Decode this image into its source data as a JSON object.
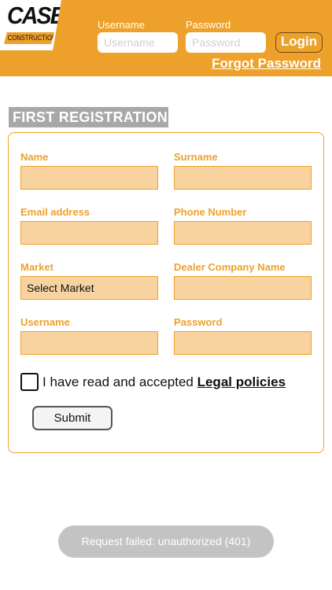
{
  "header": {
    "logo": {
      "brand": "CASE",
      "sub": "CONSTRUCTION"
    },
    "username_label": "Username",
    "username_placeholder": "Username",
    "password_label": "Password",
    "password_placeholder": "Password",
    "login_label": "Login",
    "forgot_label": "Forgot Password"
  },
  "form": {
    "title": "FIRST REGISTRATION",
    "fields": {
      "name": "Name",
      "surname": "Surname",
      "email": "Email address",
      "phone": "Phone Number",
      "market": "Market",
      "market_value": "Select Market",
      "dealer": "Dealer Company Name",
      "username": "Username",
      "password": "Password"
    },
    "agree_text": "I have read and accepted ",
    "legal_link": "Legal policies",
    "submit_label": "Submit"
  },
  "toast": {
    "message": "Request failed: unauthorized (401)"
  },
  "colors": {
    "accent": "#eda12a",
    "input_fill": "#f8d3a0",
    "title_bg": "#a8a8a8",
    "toast_bg": "#c3c3c3"
  }
}
